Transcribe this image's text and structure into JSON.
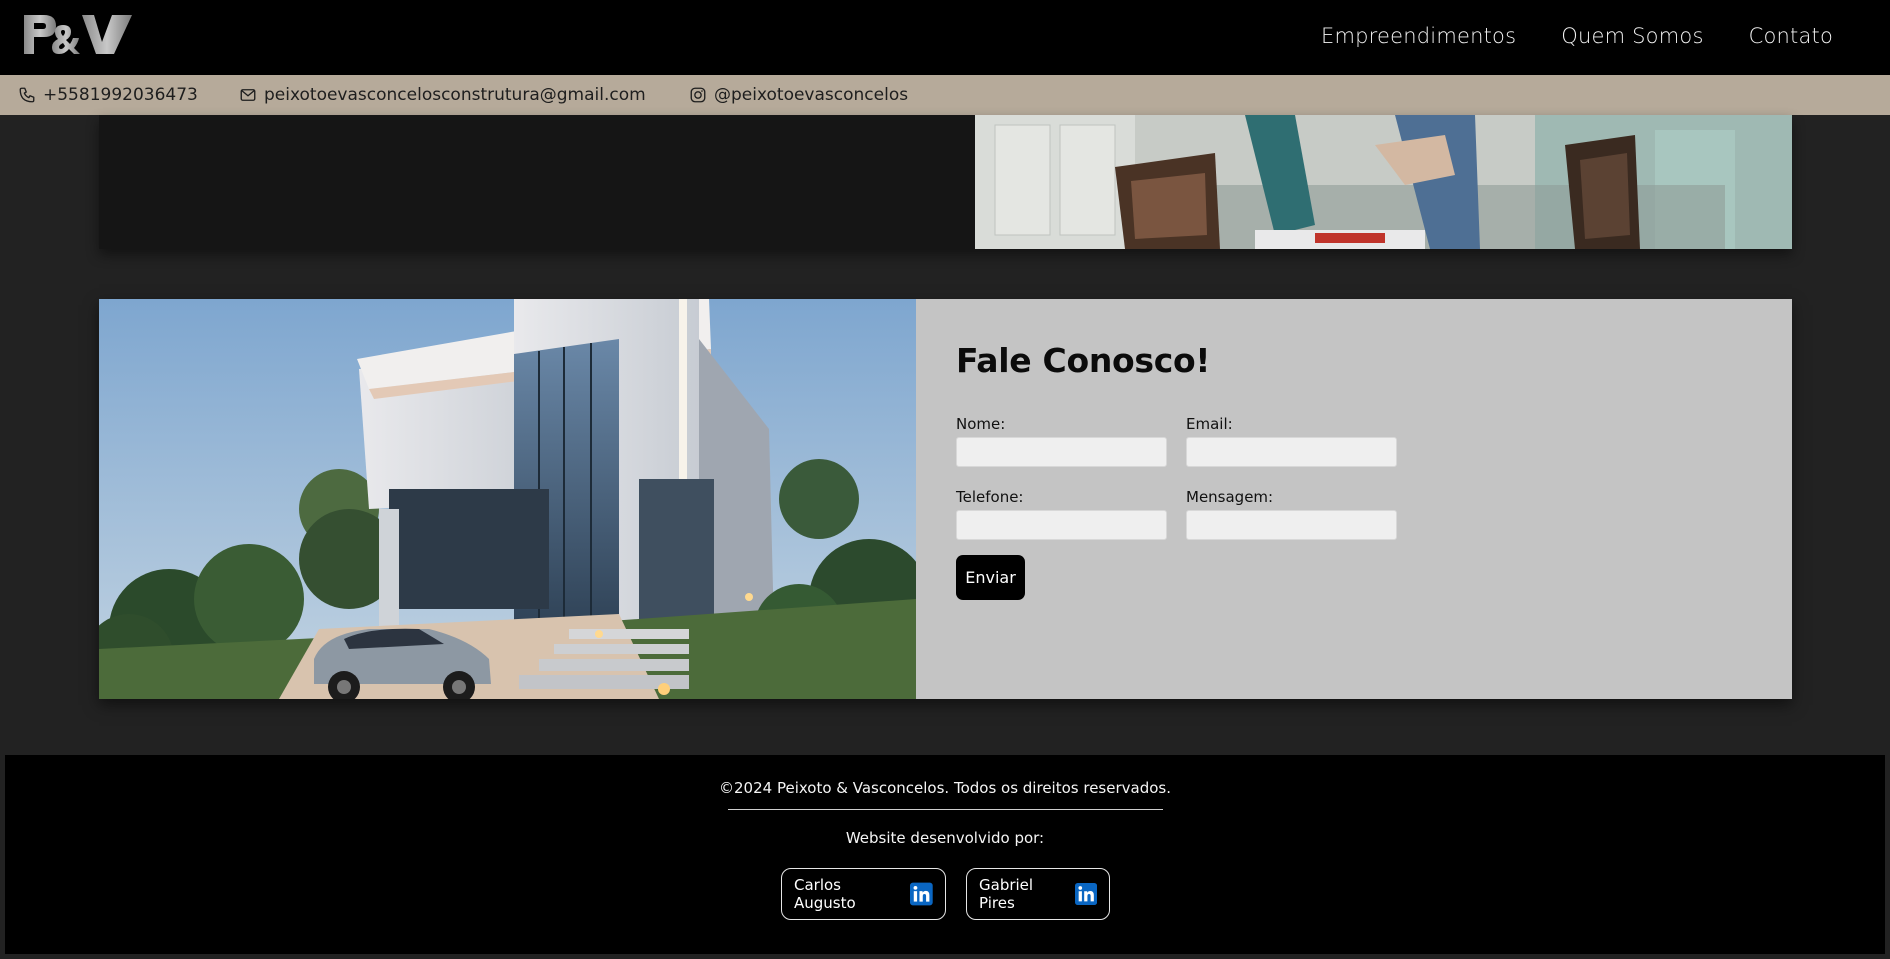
{
  "header": {
    "logo_text": "P&V",
    "nav": [
      {
        "label": "Empreendimentos"
      },
      {
        "label": "Quem Somos"
      },
      {
        "label": "Contato"
      }
    ]
  },
  "contact_bar": {
    "phone": "+5581992036473",
    "email": "peixotoevasconcelosconstrutura@gmail.com",
    "instagram": "@peixotoevasconcelos",
    "icons": [
      "phone-icon",
      "mail-icon",
      "instagram-icon"
    ]
  },
  "contact_form": {
    "title": "Fale Conosco!",
    "fields": [
      {
        "label": "Nome:",
        "value": ""
      },
      {
        "label": "Email:",
        "value": ""
      },
      {
        "label": "Telefone:",
        "value": ""
      },
      {
        "label": "Mensagem:",
        "value": ""
      }
    ],
    "submit_label": "Enviar"
  },
  "footer": {
    "copyright": "©2024 Peixoto & Vasconcelos. Todos os direitos reservados.",
    "dev_by": "Website desenvolvido por:",
    "developers": [
      {
        "name": "Carlos Augusto",
        "icon": "linkedin-icon"
      },
      {
        "name": "Gabriel Pires",
        "icon": "linkedin-icon"
      }
    ]
  },
  "colors": {
    "page_bg": "#222222",
    "header_bg": "#000000",
    "contact_bar_bg": "#b6aa9a",
    "form_card_bg": "#c4c4c4",
    "linkedin_blue": "#0a66c2"
  }
}
